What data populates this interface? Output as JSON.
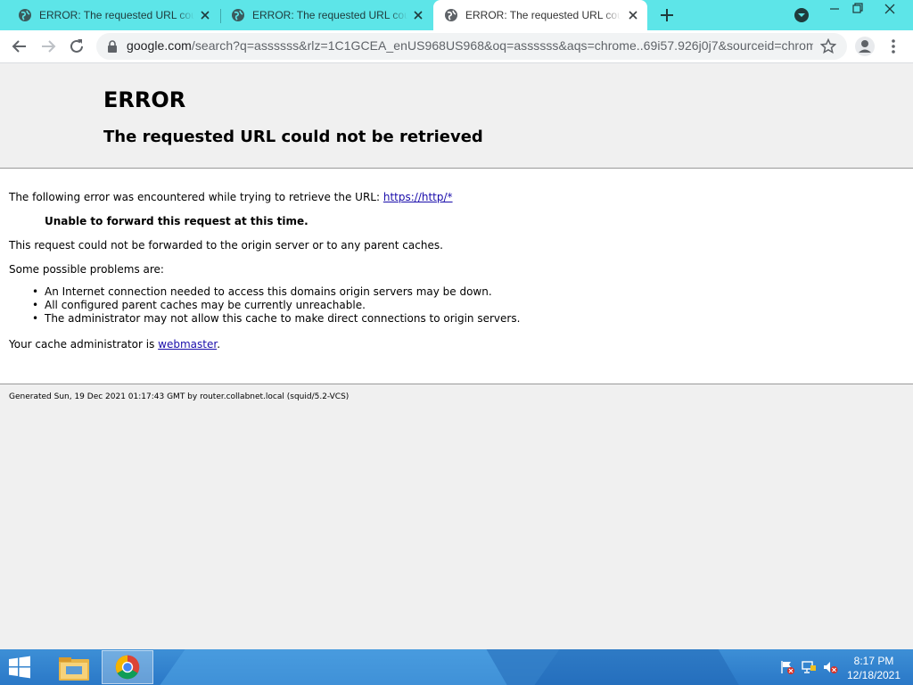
{
  "browser": {
    "tabs": [
      {
        "title": "ERROR: The requested URL could not be retrieved",
        "active": false
      },
      {
        "title": "ERROR: The requested URL could not be retrieved",
        "active": false
      },
      {
        "title": "ERROR: The requested URL could not be retrieved",
        "active": true
      }
    ],
    "address": {
      "host": "google.com",
      "rest": "/search?q=assssss&rlz=1C1GCEA_enUS968US968&oq=assssss&aqs=chrome..69i57.926j0j7&sourceid=chrome..."
    },
    "accent_color": "#5de5e8"
  },
  "page": {
    "title": "ERROR",
    "subtitle": "The requested URL could not be retrieved",
    "intro_text": "The following error was encountered while trying to retrieve the URL:",
    "intro_link": "https://http/*",
    "error_message": "Unable to forward this request at this time.",
    "explanation": "This request could not be forwarded to the origin server or to any parent caches.",
    "problems_heading": "Some possible problems are:",
    "problems": [
      "An Internet connection needed to access this domains origin servers may be down.",
      "All configured parent caches may be currently unreachable.",
      "The administrator may not allow this cache to make direct connections to origin servers."
    ],
    "admin_text": "Your cache administrator is",
    "admin_link": "webmaster",
    "admin_suffix": ".",
    "footer": "Generated Sun, 19 Dec 2021 01:17:43 GMT by router.collabnet.local (squid/5.2-VCS)"
  },
  "taskbar": {
    "pinned": [
      "file-explorer",
      "chrome"
    ],
    "tray": [
      "action-center-flag-icon",
      "network-icon",
      "volume-muted-icon"
    ],
    "time": "8:17 PM",
    "date": "12/18/2021"
  }
}
